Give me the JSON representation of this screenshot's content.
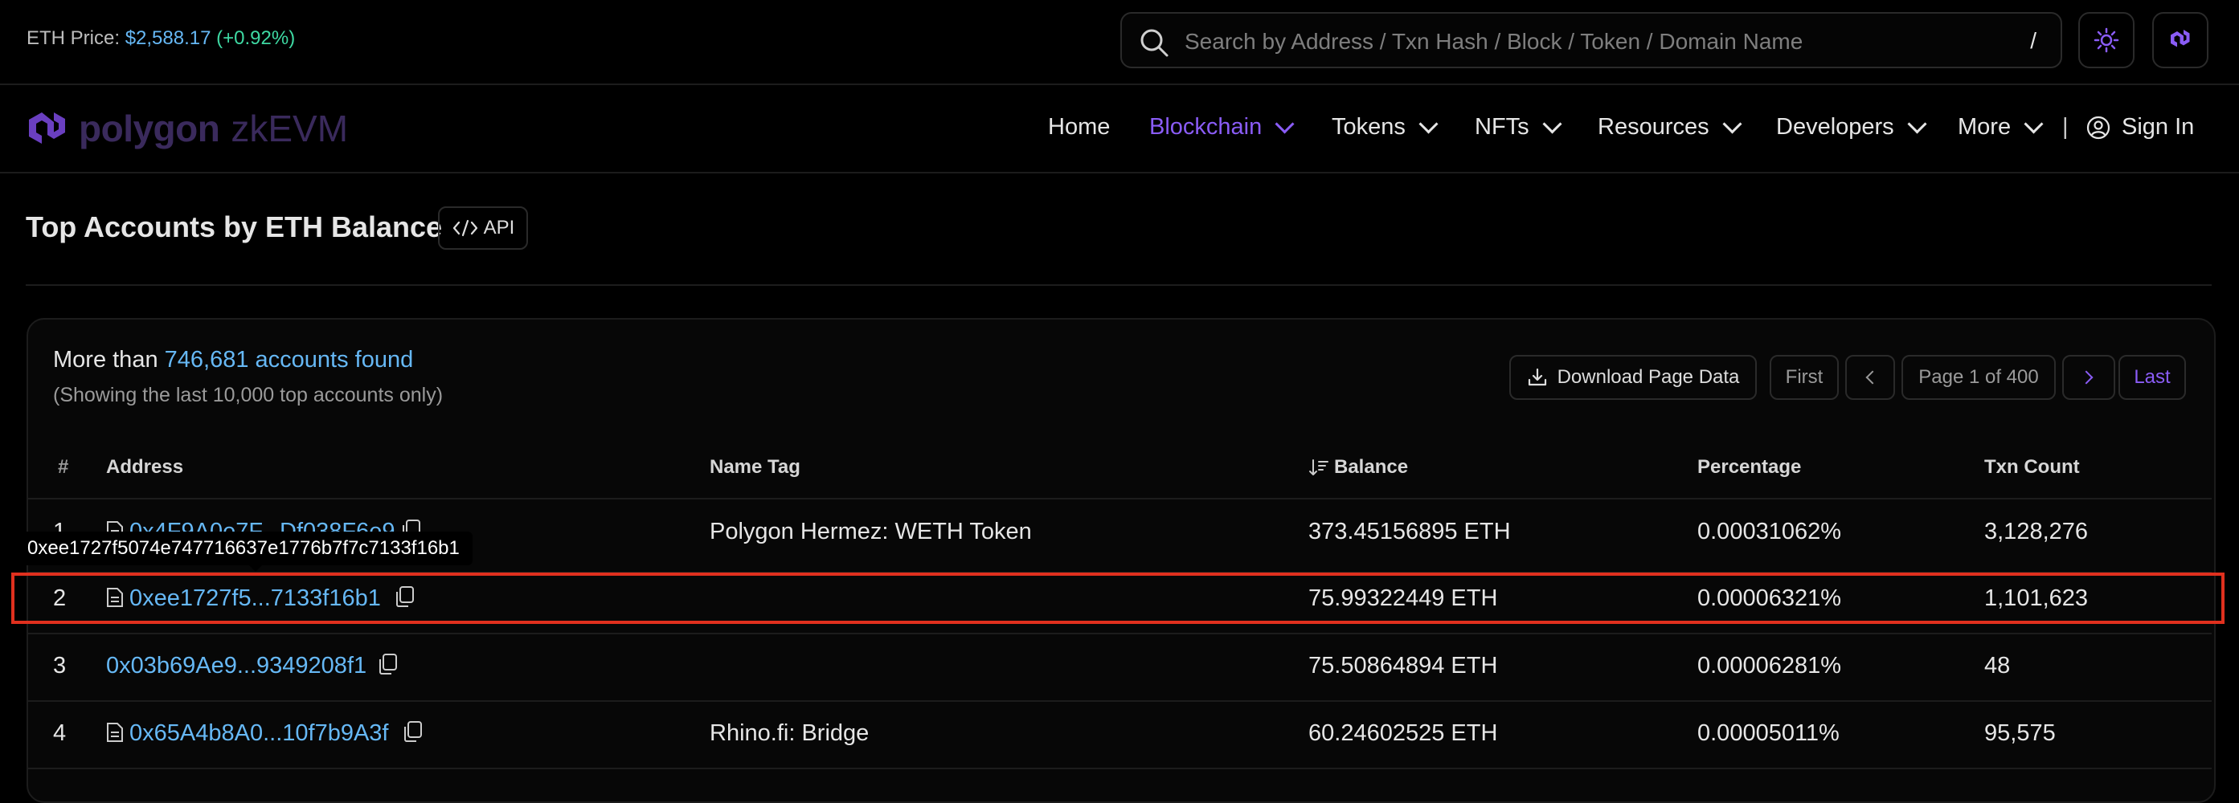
{
  "topbar": {
    "eth_price_label": "ETH Price:",
    "eth_price_value": "$2,588.17",
    "eth_price_change": "(+0.92%)",
    "search_placeholder": "Search by Address / Txn Hash / Block / Token / Domain Name",
    "search_shortcut": "/"
  },
  "brand": {
    "name": "polygon",
    "product": "zkEVM"
  },
  "nav": {
    "home": "Home",
    "blockchain": "Blockchain",
    "tokens": "Tokens",
    "nfts": "NFTs",
    "resources": "Resources",
    "developers": "Developers",
    "more": "More",
    "separator": "|",
    "sign_in": "Sign In"
  },
  "page": {
    "title": "Top Accounts by ETH Balance",
    "api_label": "API"
  },
  "summary": {
    "prefix": "More than",
    "count": "746,681 accounts found",
    "note": "(Showing the last 10,000 top accounts only)"
  },
  "pagination": {
    "download": "Download Page Data",
    "first": "First",
    "page_info": "Page 1 of 400",
    "last": "Last"
  },
  "table": {
    "headers": {
      "rank": "#",
      "address": "Address",
      "name_tag": "Name Tag",
      "balance": "Balance",
      "percentage": "Percentage",
      "txn_count": "Txn Count"
    },
    "rows": [
      {
        "rank": "1",
        "address": "0x4F9A0e7F...Df038F6e9",
        "name_tag": "Polygon Hermez: WETH Token",
        "balance": "373.45156895 ETH",
        "percentage": "0.00031062%",
        "txn_count": "3,128,276"
      },
      {
        "rank": "2",
        "address": "0xee1727f5...7133f16b1",
        "name_tag": "",
        "balance": "75.99322449 ETH",
        "percentage": "0.00006321%",
        "txn_count": "1,101,623"
      },
      {
        "rank": "3",
        "address": "0x03b69Ae9...9349208f1",
        "name_tag": "",
        "balance": "75.50864894 ETH",
        "percentage": "0.00006281%",
        "txn_count": "48"
      },
      {
        "rank": "4",
        "address": "0x65A4b8A0...10f7b9A3f",
        "name_tag": "Rhino.fi: Bridge",
        "balance": "60.24602525 ETH",
        "percentage": "0.00005011%",
        "txn_count": "95,575"
      }
    ]
  },
  "tooltip": {
    "full_address": "0xee1727f5074e747716637e1776b7f7c7133f16b1"
  },
  "colors": {
    "link": "#66b8f5",
    "accent": "#8a5cf6",
    "highlight": "#e0301e",
    "positive": "#3ed9a3"
  }
}
